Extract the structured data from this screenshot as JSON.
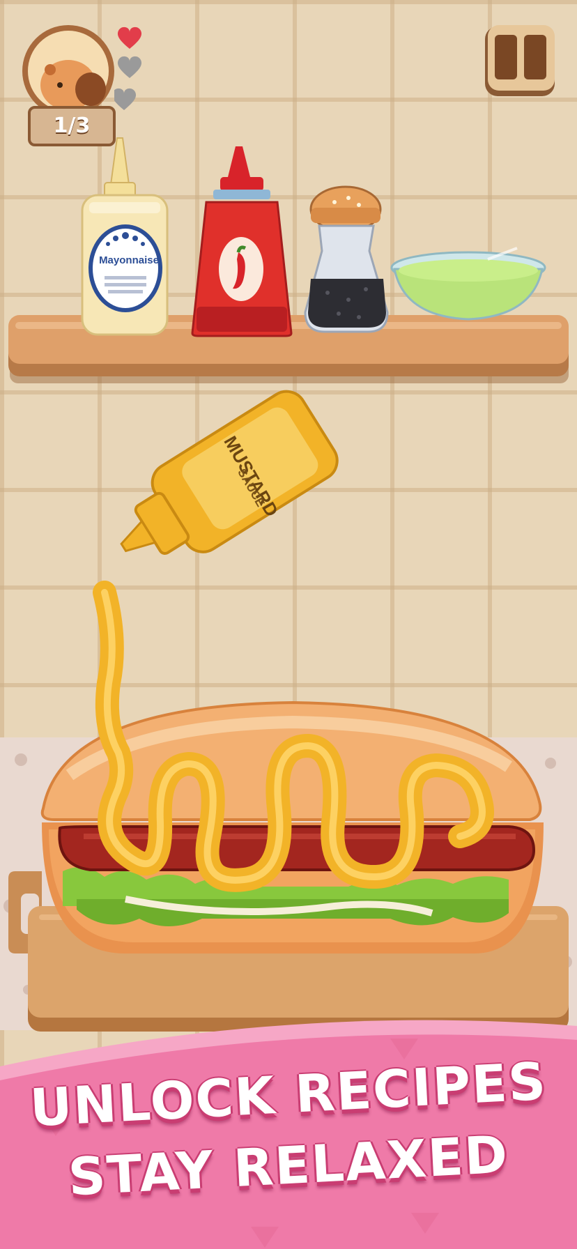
{
  "hud": {
    "progress_text": "1/3",
    "lives_remaining": 1,
    "lives_total": 3,
    "avatar": "capybara-avatar",
    "pause_icon": "pause-icon"
  },
  "shelf": {
    "mayonnaise_label": "Mayonnaise",
    "items": [
      "mayonnaise-bottle",
      "ketchup-chili-bottle",
      "pepper-shaker",
      "green-sauce-bowl"
    ]
  },
  "active_sauce": {
    "label": "MUSTARD",
    "sublabel": "SAUCE"
  },
  "banner": {
    "line1": "UNLOCK RECIPES",
    "line2": "STAY RELAXED"
  },
  "colors": {
    "heart_full": "#e23d4a",
    "heart_empty": "#9a9a9a",
    "banner_pink": "#ef7aa8",
    "mustard": "#f2b328",
    "wood": "#d79a63"
  }
}
